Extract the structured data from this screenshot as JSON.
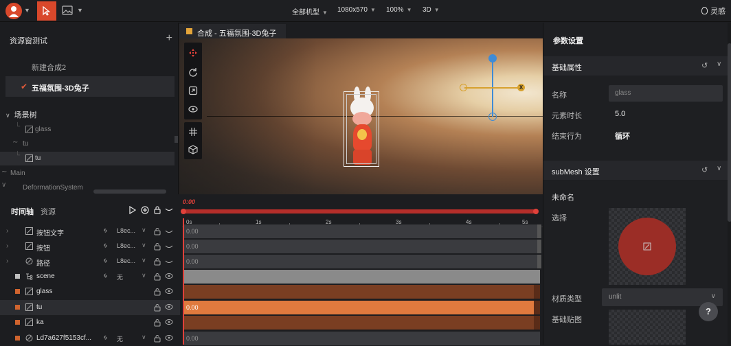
{
  "topbar": {
    "device": "全部机型",
    "resolution": "1080x570",
    "zoom": "100%",
    "mode": "3D",
    "lingan": "灵感"
  },
  "assets": {
    "title": "资源窗测试",
    "compositions": [
      "新建合成2",
      "五福氛围-3D兔子"
    ]
  },
  "scene_tree": {
    "title": "场景树",
    "nodes": [
      "glass",
      "tu",
      "tu",
      "Main",
      "DeformationSystem"
    ]
  },
  "tab": {
    "label": "合成 - 五福氛围-3D兔子"
  },
  "timeline": {
    "tab_timeline": "时间轴",
    "tab_assets": "资源",
    "current_time": "0:00",
    "ticks": [
      "0s",
      "1s",
      "2s",
      "3s",
      "4s",
      "5s"
    ],
    "rows": [
      {
        "name": "按钮文字",
        "ending": "L8ec...",
        "value": "0.00",
        "kind": "img",
        "color": "",
        "bar": "dark"
      },
      {
        "name": "按钮",
        "ending": "L8ec...",
        "value": "0.00",
        "kind": "img",
        "color": "",
        "bar": "dark"
      },
      {
        "name": "路径",
        "ending": "L8ec...",
        "value": "0.00",
        "kind": "path",
        "color": "",
        "bar": "dark"
      },
      {
        "name": "scene",
        "ending": "无",
        "value": "",
        "kind": "scene",
        "color": "#bfbfbf",
        "bar": "grey"
      },
      {
        "name": "glass",
        "ending": "",
        "value": "",
        "kind": "img",
        "color": "#d0642e",
        "bar": "brown"
      },
      {
        "name": "tu",
        "ending": "",
        "value": "0.00",
        "kind": "img",
        "color": "#d0642e",
        "bar": "orange"
      },
      {
        "name": "ka",
        "ending": "",
        "value": "",
        "kind": "img",
        "color": "#d0642e",
        "bar": "brown"
      },
      {
        "name": "Ld7a627f5153cf...",
        "ending": "无",
        "value": "0.00",
        "kind": "path",
        "color": "#d0642e",
        "bar": "dark"
      }
    ]
  },
  "params": {
    "title": "参数设置",
    "basic_section": "基础属性",
    "name_label": "名称",
    "name_value": "glass",
    "duration_label": "元素时长",
    "duration_value": "5.0",
    "end_label": "结束行为",
    "end_value": "循环",
    "submesh_section": "subMesh 设置",
    "unnamed": "未命名",
    "select_label": "选择",
    "material_label": "材质类型",
    "material_value": "unlit",
    "basemap_label": "基础贴图",
    "help": "?"
  },
  "colors": {
    "accent": "#d9482b",
    "playhead": "#e0413a",
    "track_orange": "#e07a3e",
    "track_brown": "#7a3e22"
  }
}
